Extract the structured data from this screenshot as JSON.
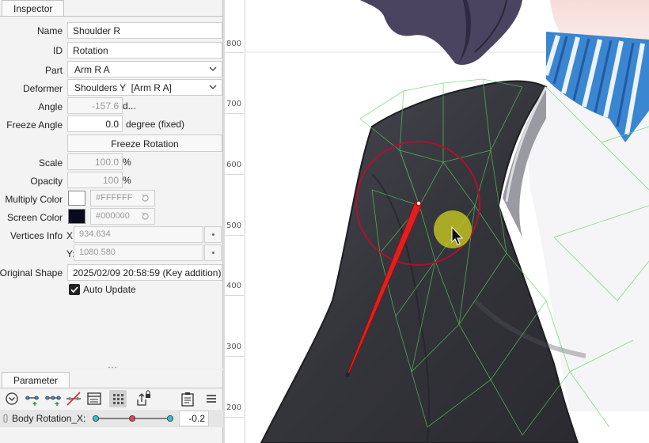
{
  "inspector": {
    "tab_label": "Inspector",
    "name_label": "Name",
    "name_value": "Shoulder R",
    "id_label": "ID",
    "id_value": "Rotation",
    "part_label": "Part",
    "part_value": "Arm R A",
    "deformer_label": "Deformer",
    "deformer_value": "Shoulders Y  [Arm R A]",
    "angle_label": "Angle",
    "angle_value": "-157.6",
    "angle_unit": "d...",
    "freeze_angle_label": "Freeze Angle",
    "freeze_angle_value": "0.0",
    "freeze_angle_unit": "degree (fixed)",
    "freeze_rotation_button": "Freeze Rotation",
    "scale_label": "Scale",
    "scale_value": "100.0",
    "scale_unit": "%",
    "opacity_label": "Opacity",
    "opacity_value": "100",
    "opacity_unit": "%",
    "multiply_color_label": "Multiply Color",
    "multiply_color_value": "#FFFFFF",
    "multiply_color_swatch": "#ffffff",
    "screen_color_label": "Screen Color",
    "screen_color_value": "#000000",
    "screen_color_swatch": "#0a0a1e",
    "vertices_info_label": "Vertices Info",
    "x_label": "X:",
    "x_value": "934.634",
    "y_label": "Y:",
    "y_value": "1080.580",
    "original_shape_label": "Original Shape",
    "original_shape_value": "2025/02/09 20:58:59 (Key addition)",
    "auto_update_label": "Auto Update",
    "auto_update_checked": true
  },
  "parameter": {
    "tab_label": "Parameter",
    "toolbar_icons": [
      "collapse-icon",
      "add-key-icon",
      "add-three-keys-icon",
      "delete-key-icon",
      "keyform-panel-icon",
      "grid-view-icon",
      "export-lock-icon",
      "clipboard-icon",
      "menu-icon"
    ],
    "param_name": "Body Rotation_X:",
    "param_value": "-0.2",
    "param_fraction": 0.49
  },
  "ruler": {
    "labels": [
      "800",
      "700",
      "600",
      "500",
      "400",
      "300",
      "200"
    ]
  },
  "colors": {
    "rotation_handle": "#e02020",
    "rotation_circle": "#b01030",
    "cursor_highlight": "#c8c820",
    "mesh_lines": "#5ad25a"
  }
}
